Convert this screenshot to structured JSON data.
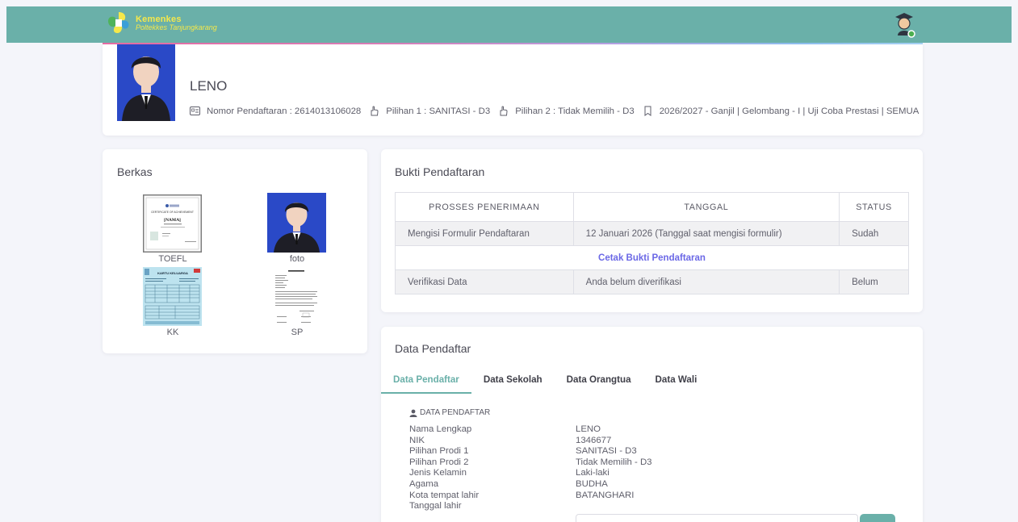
{
  "header": {
    "logo_line1": "Kemenkes",
    "logo_line2": "Poltekkes Tanjungkarang"
  },
  "profile": {
    "name": "LENO",
    "nomor": "Nomor Pendaftaran : 2614013106028",
    "pilihan1": "Pilihan 1 : SANITASI - D3",
    "pilihan2": "Pilihan 2 : Tidak Memilih - D3",
    "periode": "2026/2027 - Ganjil | Gelombang - I | Uji Coba Prestasi | SEMUA"
  },
  "berkas": {
    "title": "Berkas",
    "files": [
      {
        "label": "TOEFL",
        "cert_title": "CERTIFICATE OF ACHIEVEMENT",
        "cert_name": "[NAMA]"
      },
      {
        "label": "foto"
      },
      {
        "label": "KK",
        "doc_title": "KARTU KELUARGA"
      },
      {
        "label": "SP"
      }
    ]
  },
  "bukti": {
    "title": "Bukti Pendaftaran",
    "columns": [
      "PROSSES PENERIMAAN",
      "TANGGAL",
      "STATUS"
    ],
    "rows": [
      {
        "proses": "Mengisi Formulir Pendaftaran",
        "tanggal": "12 Januari 2026 (Tanggal saat mengisi formulir)",
        "status": "Sudah"
      },
      {
        "link": "Cetak Bukti Pendaftaran"
      },
      {
        "proses": "Verifikasi Data",
        "tanggal": "Anda belum diverifikasi",
        "status": "Belum"
      }
    ]
  },
  "data_pendaftar": {
    "title": "Data Pendaftar",
    "tabs": [
      "Data Pendaftar",
      "Data Sekolah",
      "Data Orangtua",
      "Data Wali"
    ],
    "section": "DATA PENDAFTAR",
    "fields": [
      {
        "k": "Nama Lengkap",
        "v": "LENO"
      },
      {
        "k": "NIK",
        "v": "1346677"
      },
      {
        "k": "Pilihan Prodi 1",
        "v": "SANITASI - D3"
      },
      {
        "k": "Pilihan Prodi 2",
        "v": "Tidak Memilih - D3"
      },
      {
        "k": "Jenis Kelamin",
        "v": "Laki-laki"
      },
      {
        "k": "Agama",
        "v": "BUDHA"
      },
      {
        "k": "Kota tempat lahir",
        "v": "BATANGHARI"
      },
      {
        "k": "Tanggal lahir",
        "v": ""
      }
    ]
  },
  "colors": {
    "primary": "#6ab0a9",
    "link": "#6b68e6",
    "photo_bg": "#2a49c7"
  }
}
